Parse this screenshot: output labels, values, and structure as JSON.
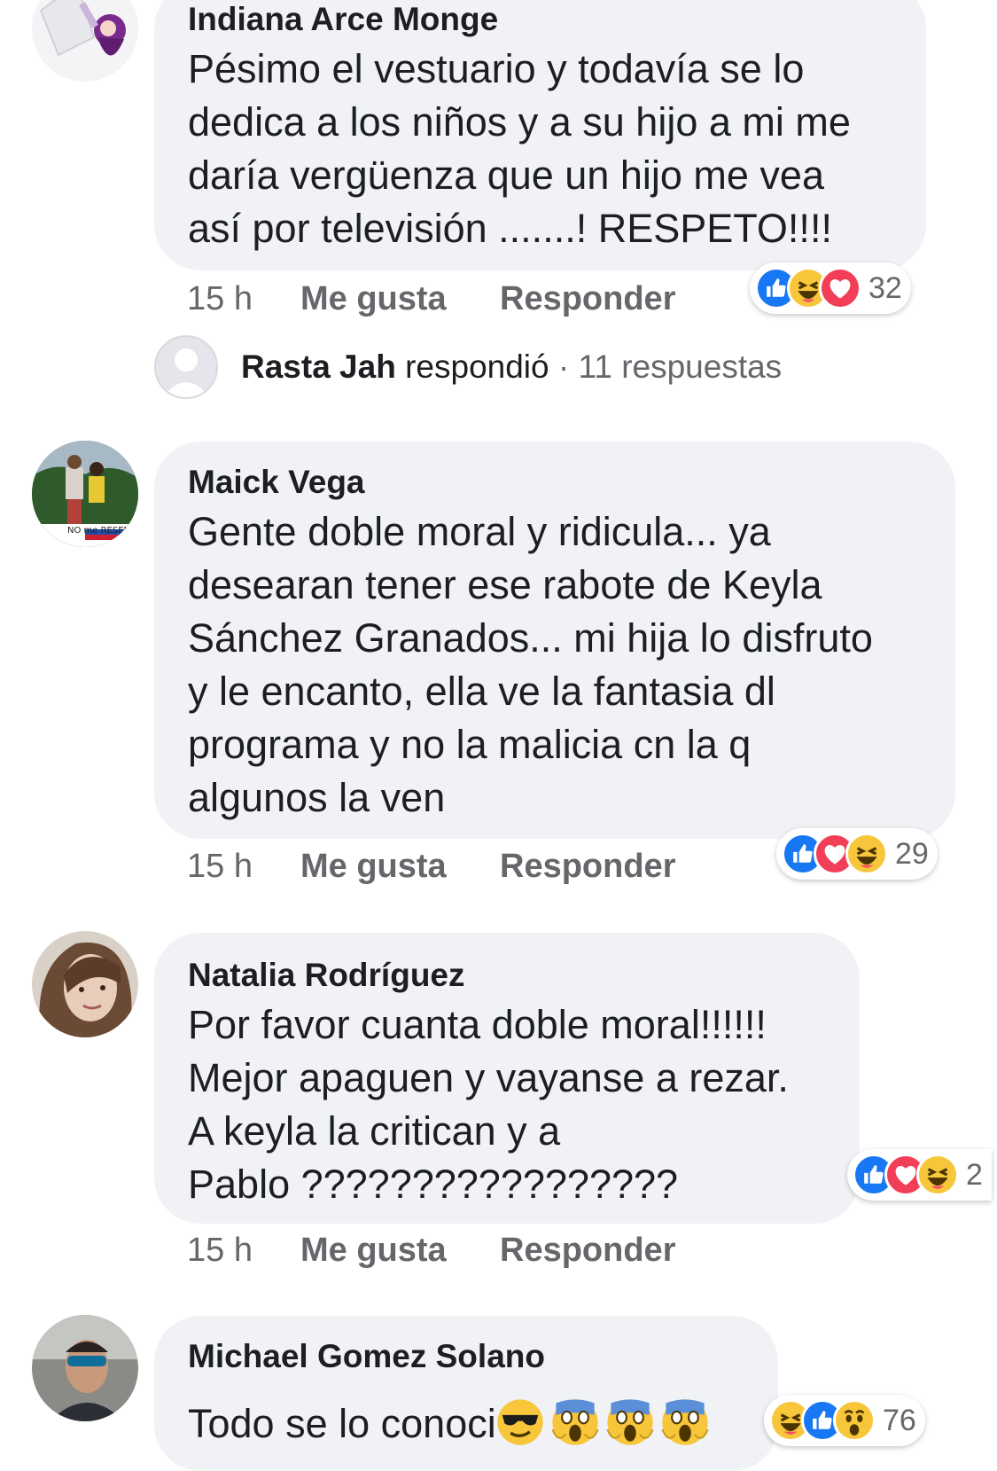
{
  "comments": [
    {
      "author": "Indiana Arce Monge",
      "lines": [
        "Pésimo el vestuario y todavía se lo",
        "dedica a los niños y a su hijo a mi me",
        "daría  vergüenza que un hijo me vea",
        "así por televisión .......! RESPETO!!!!"
      ],
      "time": "15 h",
      "like_label": "Me gusta",
      "reply_label": "Responder",
      "reactions": [
        "like-icon",
        "haha-icon",
        "love-icon"
      ],
      "reaction_count": "32"
    },
    {
      "author": "Maick Vega",
      "lines": [
        "Gente doble moral y ridicula... ya",
        "desearan tener ese rabote de Keyla",
        "Sánchez Granados... mi hija lo disfruto",
        "y le encanto, ella ve la fantasia dl",
        "programa y no la malicia  cn la q",
        "algunos la ven"
      ],
      "avatar_text": "NO me RESENTA",
      "time": "15 h",
      "like_label": "Me gusta",
      "reply_label": "Responder",
      "reactions": [
        "like-icon",
        "love-icon",
        "haha-icon"
      ],
      "reaction_count": "29"
    },
    {
      "author": "Natalia Rodríguez",
      "lines": [
        "Por favor cuanta doble moral!!!!!!",
        "Mejor apaguen y vayanse a rezar.",
        "A keyla la critican y a",
        "Pablo ?????????????????"
      ],
      "time": "15 h",
      "like_label": "Me gusta",
      "reply_label": "Responder",
      "reactions": [
        "like-icon",
        "love-icon",
        "haha-icon"
      ],
      "reaction_count": "2"
    },
    {
      "author": "Michael Gomez Solano",
      "text": "Todo se lo conoci",
      "emojis": [
        "sunglasses-emoji",
        "scream-emoji",
        "scream-emoji",
        "scream-emoji"
      ],
      "reactions": [
        "haha-icon",
        "like-icon",
        "wow-icon"
      ],
      "reaction_count": "76"
    }
  ],
  "reply_summary": {
    "name": "Rasta Jah",
    "verb": "respondió",
    "separator": "·",
    "count": "11 respuestas"
  },
  "colors": {
    "bubble": "#f0f2f5",
    "meta_text": "#65676b",
    "like": "#1877f2",
    "love": "#f33e58",
    "haha": "#f7c63b"
  }
}
